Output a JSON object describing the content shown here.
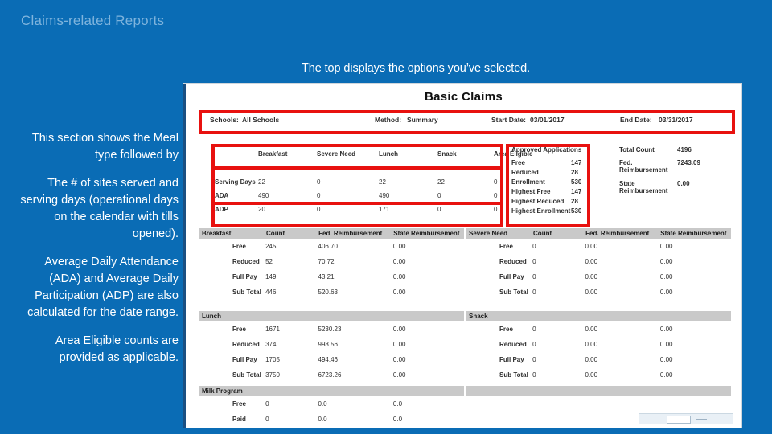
{
  "slide": {
    "title": "Claims-related Reports",
    "headline": "The top displays the options you’ve selected.",
    "accent_blue": "#0a6cb5",
    "title_color": "#7fb4dd",
    "highlight_color": "#e8110f"
  },
  "callouts": [
    "This section shows the Meal type followed by",
    "The # of sites served and serving days (operational days on the calendar with tills opened).",
    "Average Daily Attendance (ADA) and Average Daily Participation (ADP) are also calculated for the date range.",
    "Area Eligible counts are provided as applicable."
  ],
  "report": {
    "title": "Basic Claims",
    "header": {
      "schools_label": "Schools:",
      "schools_value": "All Schools",
      "method_label": "Method:",
      "method_value": "Summary",
      "start_label": "Start Date:",
      "start_value": "03/01/2017",
      "end_label": "End Date:",
      "end_value": "03/31/2017"
    },
    "summary": {
      "columns": [
        "",
        "Breakfast",
        "Severe Need",
        "Lunch",
        "Snack",
        "Area Eligible"
      ],
      "rows": [
        {
          "label": "Schools",
          "values": [
            "1",
            "0",
            "1",
            "0",
            "0"
          ]
        },
        {
          "label": "Serving Days",
          "values": [
            "22",
            "0",
            "22",
            "22",
            "0"
          ]
        },
        {
          "label": "ADA",
          "values": [
            "490",
            "0",
            "490",
            "0",
            "0"
          ]
        },
        {
          "label": "ADP",
          "values": [
            "20",
            "0",
            "171",
            "0",
            "0"
          ]
        }
      ]
    },
    "applications": {
      "heading": "Approved Applications",
      "left_rows": [
        {
          "label": "Free",
          "value": "147"
        },
        {
          "label": "Reduced",
          "value": "28"
        },
        {
          "label": "Enrollment",
          "value": "530"
        },
        {
          "label": "Highest Free",
          "value": "147"
        },
        {
          "label": "Highest Reduced",
          "value": "28"
        },
        {
          "label": "Highest Enrollment",
          "value": "530"
        }
      ],
      "right_rows": [
        {
          "label": "Total Count",
          "value": "4196"
        },
        {
          "label": "Fed. Reimbursement",
          "value": "7243.09"
        },
        {
          "label": "State Reimbursement",
          "value": "0.00"
        }
      ]
    },
    "detail_columns": [
      "Count",
      "Fed. Reimbursement",
      "State Reimbursement"
    ],
    "meal_blocks": [
      {
        "name": "Breakfast",
        "rows": [
          {
            "label": "Free",
            "count": "245",
            "fed": "406.70",
            "state": "0.00"
          },
          {
            "label": "Reduced",
            "count": "52",
            "fed": "70.72",
            "state": "0.00"
          },
          {
            "label": "Full Pay",
            "count": "149",
            "fed": "43.21",
            "state": "0.00"
          },
          {
            "label": "Sub Total",
            "count": "446",
            "fed": "520.63",
            "state": "0.00"
          }
        ]
      },
      {
        "name": "Severe Need",
        "rows": [
          {
            "label": "Free",
            "count": "0",
            "fed": "0.00",
            "state": "0.00"
          },
          {
            "label": "Reduced",
            "count": "0",
            "fed": "0.00",
            "state": "0.00"
          },
          {
            "label": "Full Pay",
            "count": "0",
            "fed": "0.00",
            "state": "0.00"
          },
          {
            "label": "Sub Total",
            "count": "0",
            "fed": "0.00",
            "state": "0.00"
          }
        ]
      },
      {
        "name": "Lunch",
        "rows": [
          {
            "label": "Free",
            "count": "1671",
            "fed": "5230.23",
            "state": "0.00"
          },
          {
            "label": "Reduced",
            "count": "374",
            "fed": "998.56",
            "state": "0.00"
          },
          {
            "label": "Full Pay",
            "count": "1705",
            "fed": "494.46",
            "state": "0.00"
          },
          {
            "label": "Sub Total",
            "count": "3750",
            "fed": "6723.26",
            "state": "0.00"
          }
        ]
      },
      {
        "name": "Snack",
        "rows": [
          {
            "label": "Free",
            "count": "0",
            "fed": "0.00",
            "state": "0.00"
          },
          {
            "label": "Reduced",
            "count": "0",
            "fed": "0.00",
            "state": "0.00"
          },
          {
            "label": "Full Pay",
            "count": "0",
            "fed": "0.00",
            "state": "0.00"
          },
          {
            "label": "Sub Total",
            "count": "0",
            "fed": "0.00",
            "state": "0.00"
          }
        ]
      },
      {
        "name": "Milk Program",
        "rows": [
          {
            "label": "Free",
            "count": "0",
            "fed": "0.0",
            "state": "0.0"
          },
          {
            "label": "Paid",
            "count": "0",
            "fed": "0.0",
            "state": "0.0"
          }
        ]
      }
    ]
  }
}
